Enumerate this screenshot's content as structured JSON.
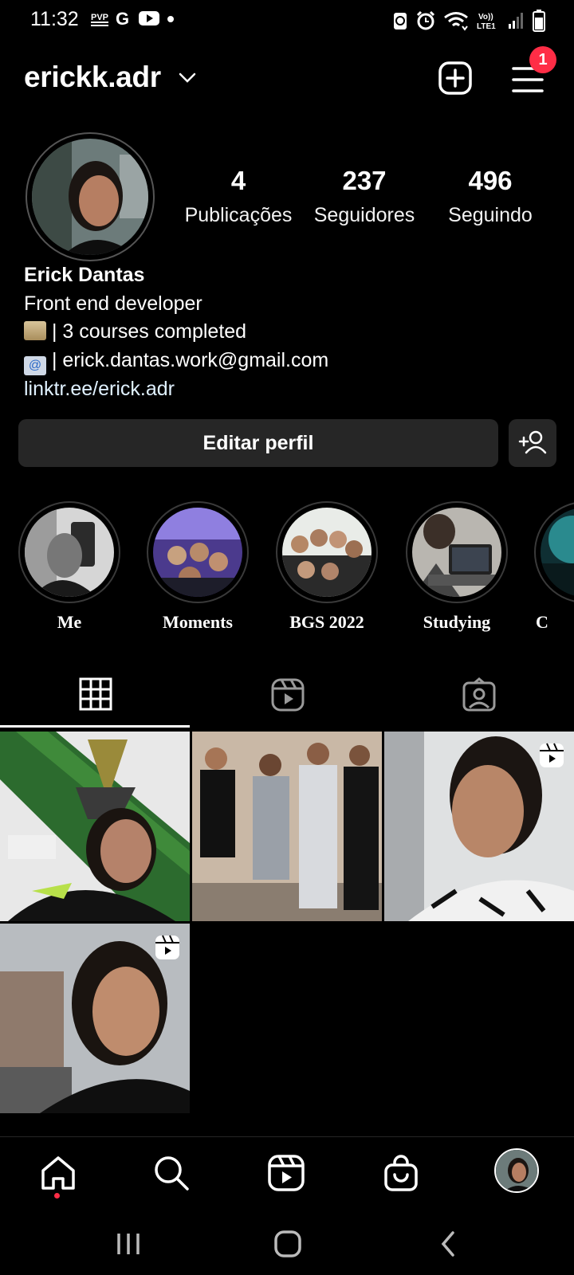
{
  "status_bar": {
    "time": "11:32",
    "left_icons": [
      "pvp-icon",
      "google-icon",
      "youtube-icon",
      "dot-icon"
    ],
    "right_icons": [
      "data-saver-icon",
      "alarm-icon",
      "wifi-icon",
      "volte-icon",
      "signal-icon",
      "battery-icon"
    ],
    "volte_label": "Vo)) LTE1"
  },
  "header": {
    "username": "erickk.adr",
    "notification_count": "1"
  },
  "profile": {
    "stats": [
      {
        "value": "4",
        "label": "Publicações"
      },
      {
        "value": "237",
        "label": "Seguidores"
      },
      {
        "value": "496",
        "label": "Seguindo"
      }
    ],
    "name": "Erick Dantas",
    "bio_lines": [
      "Front end developer",
      "| 3 courses completed",
      "| erick.dantas.work@gmail.com"
    ],
    "link": "linktr.ee/erick.adr",
    "edit_button": "Editar perfil"
  },
  "highlights": [
    {
      "label": "Me"
    },
    {
      "label": "Moments"
    },
    {
      "label": "BGS 2022"
    },
    {
      "label": "Studying"
    },
    {
      "label": "C"
    }
  ],
  "tabs": [
    "grid-icon",
    "reels-icon",
    "tagged-icon"
  ],
  "posts": [
    {
      "type": "photo"
    },
    {
      "type": "photo"
    },
    {
      "type": "reel"
    },
    {
      "type": "reel"
    }
  ],
  "bottom_nav": [
    "home-icon",
    "search-icon",
    "reels-icon",
    "shop-icon",
    "profile-avatar"
  ],
  "colors": {
    "background": "#000000",
    "button": "#262626",
    "badge": "#ff2d46",
    "text": "#ffffff"
  }
}
